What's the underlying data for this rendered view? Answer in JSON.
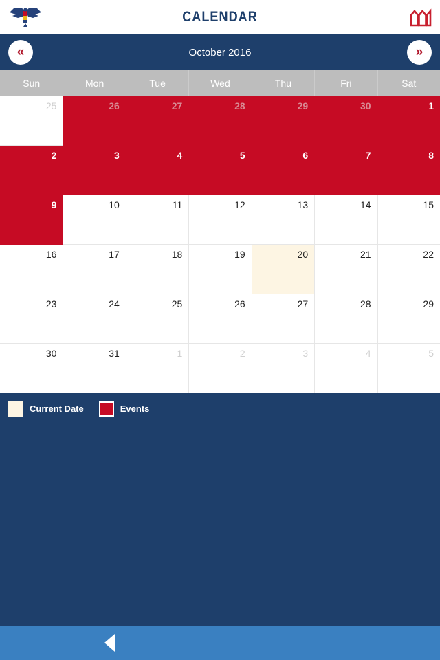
{
  "appbar": {
    "title": "CALENDAR",
    "logo_icon": "eagle-logo-icon",
    "right_icon": "building-columns-icon"
  },
  "monthbar": {
    "prev_label": "«",
    "next_label": "»",
    "month_label": "October 2016"
  },
  "weekdays": [
    "Sun",
    "Mon",
    "Tue",
    "Wed",
    "Thu",
    "Fri",
    "Sat"
  ],
  "legend": {
    "current_date_label": "Current Date",
    "events_label": "Events"
  },
  "bottombar": {
    "back_icon": "back-triangle-icon"
  },
  "colors": {
    "navy": "#1e3f6b",
    "red": "#c60b24",
    "cream": "#fdf5e3",
    "weekday_gray": "#bdbdbd",
    "bottom_blue": "#3a80c1",
    "white": "#ffffff"
  },
  "calendar": {
    "month": "October",
    "year": 2016,
    "current_date": 20,
    "cells": [
      {
        "day": "25",
        "state": "out"
      },
      {
        "day": "26",
        "state": "event-muted"
      },
      {
        "day": "27",
        "state": "event-muted"
      },
      {
        "day": "28",
        "state": "event-muted"
      },
      {
        "day": "29",
        "state": "event-muted"
      },
      {
        "day": "30",
        "state": "event-muted"
      },
      {
        "day": "1",
        "state": "event"
      },
      {
        "day": "2",
        "state": "event"
      },
      {
        "day": "3",
        "state": "event"
      },
      {
        "day": "4",
        "state": "event"
      },
      {
        "day": "5",
        "state": "event"
      },
      {
        "day": "6",
        "state": "event"
      },
      {
        "day": "7",
        "state": "event"
      },
      {
        "day": "8",
        "state": "event"
      },
      {
        "day": "9",
        "state": "event"
      },
      {
        "day": "10",
        "state": "normal"
      },
      {
        "day": "11",
        "state": "normal"
      },
      {
        "day": "12",
        "state": "normal"
      },
      {
        "day": "13",
        "state": "normal"
      },
      {
        "day": "14",
        "state": "normal"
      },
      {
        "day": "15",
        "state": "normal"
      },
      {
        "day": "16",
        "state": "normal"
      },
      {
        "day": "17",
        "state": "normal"
      },
      {
        "day": "18",
        "state": "normal"
      },
      {
        "day": "19",
        "state": "normal"
      },
      {
        "day": "20",
        "state": "today"
      },
      {
        "day": "21",
        "state": "normal"
      },
      {
        "day": "22",
        "state": "normal"
      },
      {
        "day": "23",
        "state": "normal"
      },
      {
        "day": "24",
        "state": "normal"
      },
      {
        "day": "25",
        "state": "normal"
      },
      {
        "day": "26",
        "state": "normal"
      },
      {
        "day": "27",
        "state": "normal"
      },
      {
        "day": "28",
        "state": "normal"
      },
      {
        "day": "29",
        "state": "normal"
      },
      {
        "day": "30",
        "state": "normal"
      },
      {
        "day": "31",
        "state": "normal"
      },
      {
        "day": "1",
        "state": "out"
      },
      {
        "day": "2",
        "state": "out"
      },
      {
        "day": "3",
        "state": "out"
      },
      {
        "day": "4",
        "state": "out"
      },
      {
        "day": "5",
        "state": "out"
      }
    ]
  }
}
